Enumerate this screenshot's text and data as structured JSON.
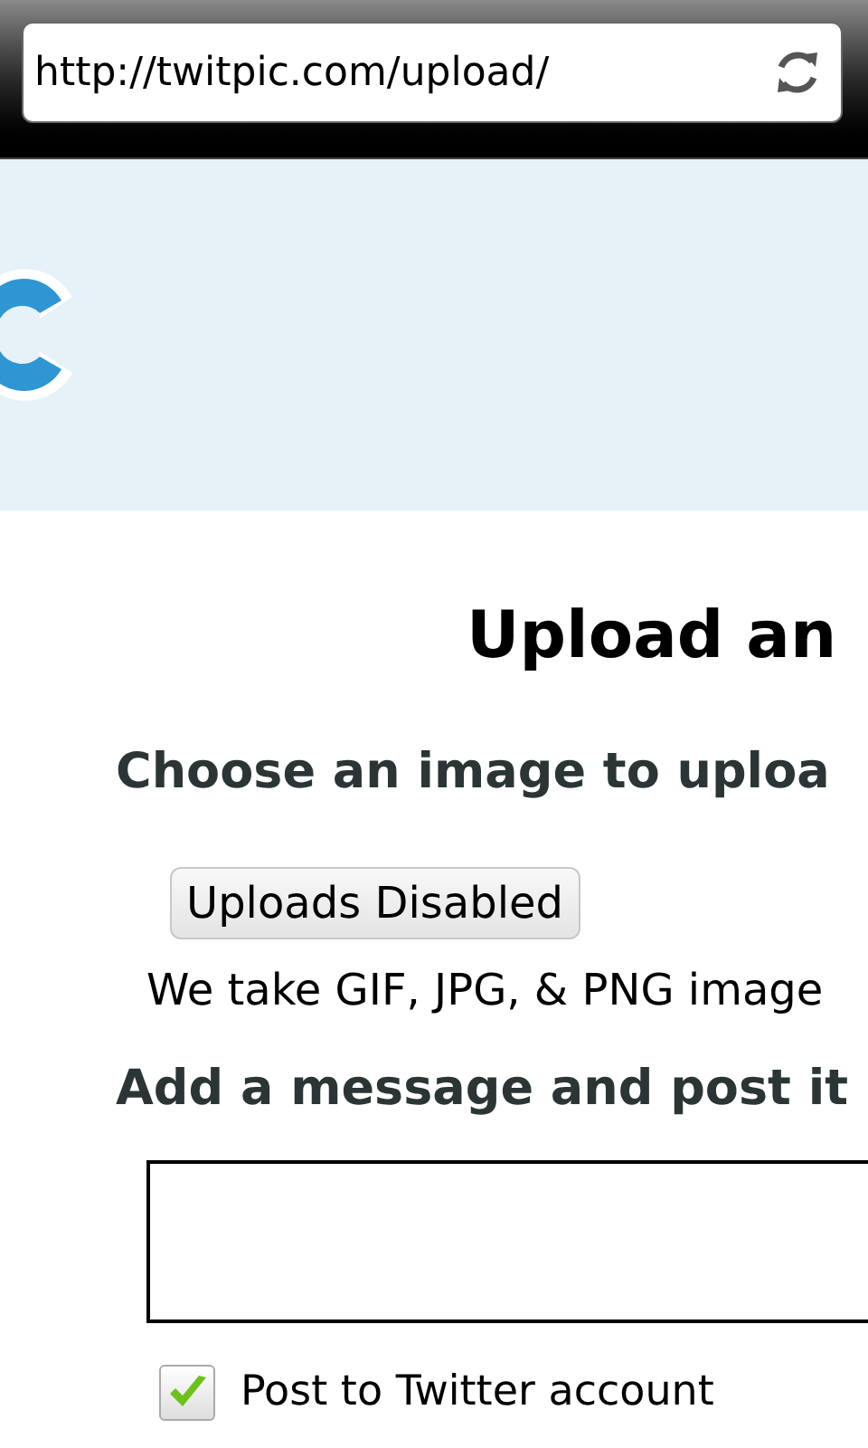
{
  "browser": {
    "url": "http://twitpic.com/upload/"
  },
  "page": {
    "title": "Upload an",
    "choose_label": "Choose an image to uploa",
    "upload_button": {
      "label": "Uploads Disabled",
      "disabled": true
    },
    "formats_note": "We take GIF, JPG, & PNG image",
    "message_label": "Add a message and post it",
    "post_to_twitter": {
      "label": "Post to Twitter account",
      "checked": true
    }
  }
}
